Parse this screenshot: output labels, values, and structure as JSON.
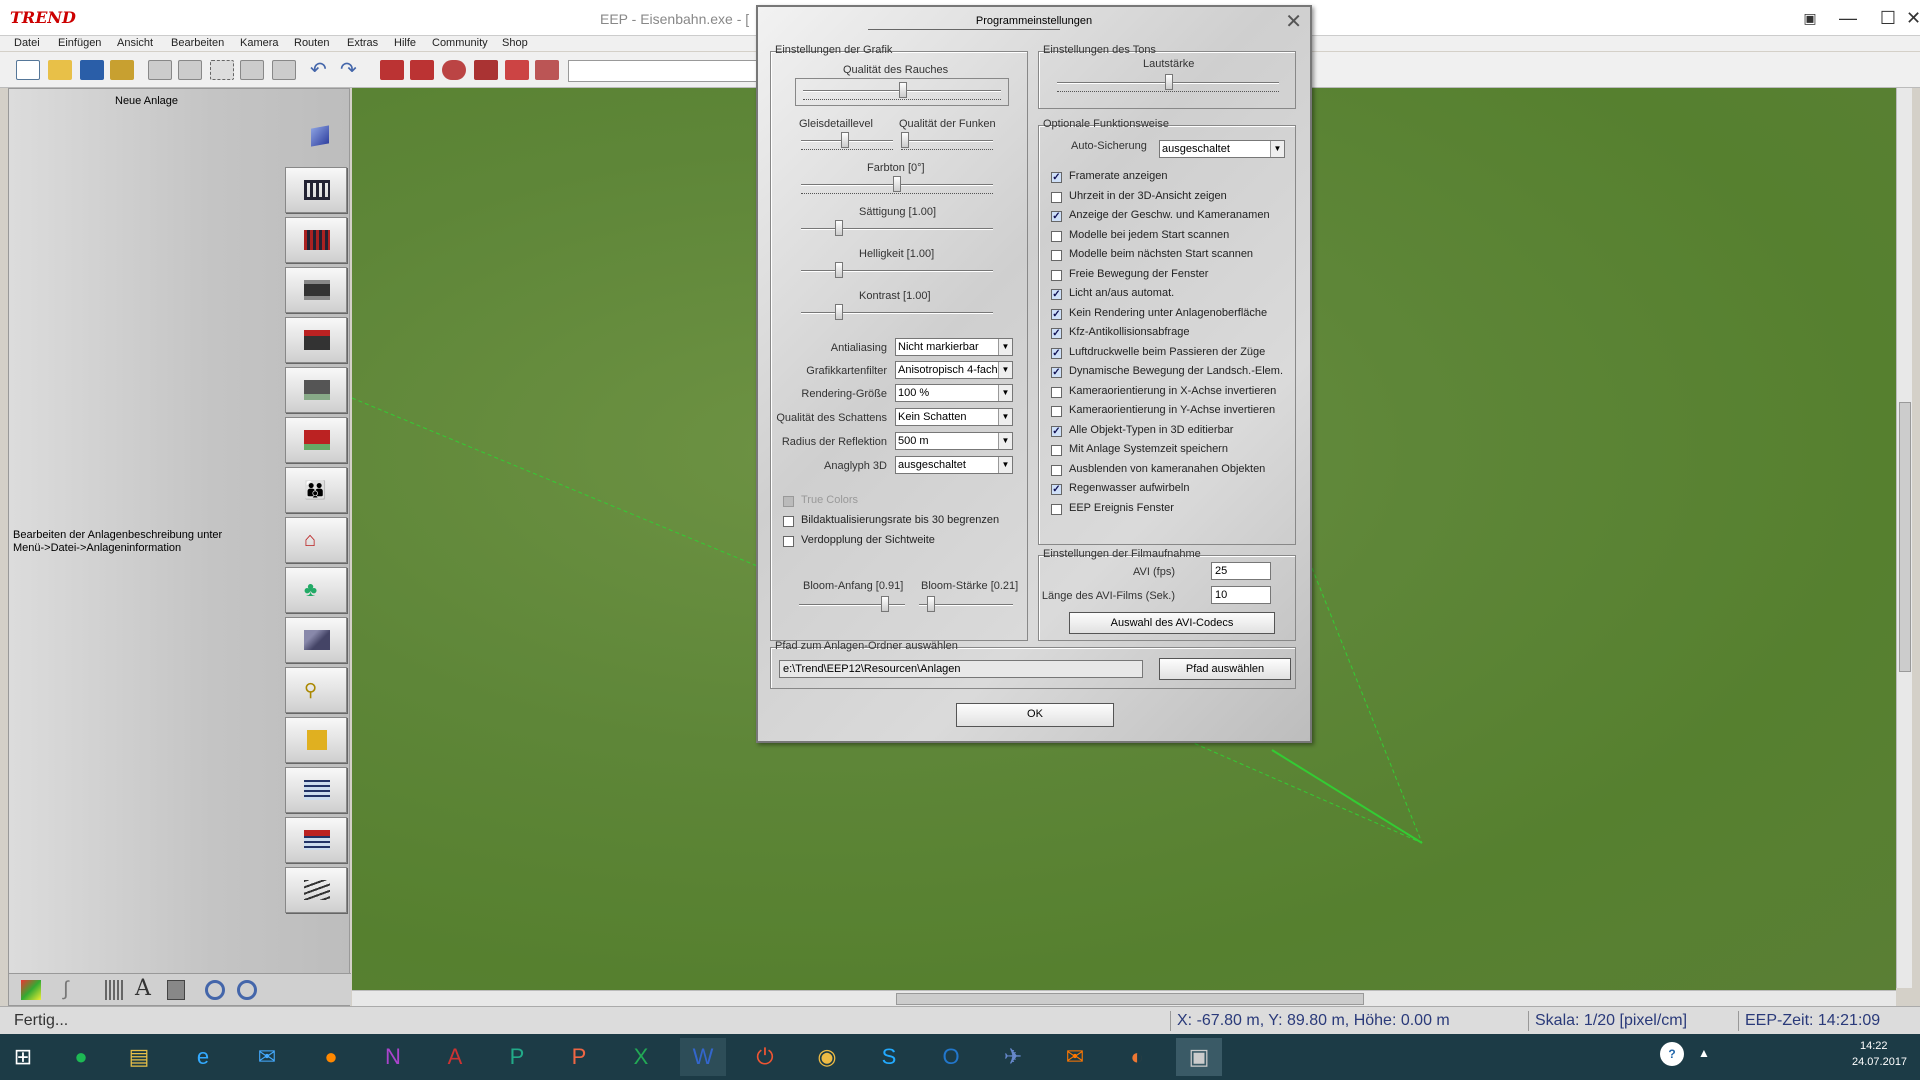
{
  "window": {
    "title": "EEP - Eisenbahn.exe - [",
    "logo": "TREND"
  },
  "menu": [
    "Datei",
    "Einfügen",
    "Ansicht",
    "Bearbeiten",
    "Kamera",
    "Routen",
    "Extras",
    "Hilfe",
    "Community",
    "Shop"
  ],
  "left_panel": {
    "title": "Neue Anlage",
    "description": "Bearbeiten der Anlagenbeschreibung unter Menü->Datei->Anlageninformation",
    "buttons": [
      "rails-icon",
      "tram-rails-icon",
      "road-icon",
      "road-tram-icon",
      "road-track-icon",
      "water-track-icon",
      "people-icon",
      "house-icon",
      "tree-icon",
      "landscape-icon",
      "signal-icon",
      "goods-icon",
      "water-icon",
      "water-surface-icon",
      "tracks-switch-icon"
    ]
  },
  "statusbar": {
    "state": "Fertig...",
    "coords": "X: -67.80 m, Y: 89.80 m, Höhe: 0.00 m",
    "scale": "Skala: 1/20 [pixel/cm]",
    "time": "EEP-Zeit: 14:21:09"
  },
  "dialog": {
    "title": "Programmeinstellungen",
    "graphics": {
      "label": "Einstellungen der Grafik",
      "smoke_label": "Qualität des Rauches",
      "track_detail_label": "Gleisdetaillevel",
      "sparks_label": "Qualität der Funken",
      "hue_label": "Farbton [0°]",
      "saturation_label": "Sättigung [1.00]",
      "brightness_label": "Helligkeit [1.00]",
      "contrast_label": "Kontrast [1.00]",
      "dropdowns": [
        {
          "label": "Antialiasing",
          "value": "Nicht markierbar"
        },
        {
          "label": "Grafikkartenfilter",
          "value": "Anisotropisch 4-fach"
        },
        {
          "label": "Rendering-Größe",
          "value": "100 %"
        },
        {
          "label": "Qualität des Schattens",
          "value": "Kein Schatten"
        },
        {
          "label": "Radius der Reflektion",
          "value": "500 m"
        },
        {
          "label": "Anaglyph 3D",
          "value": "ausgeschaltet"
        }
      ],
      "checkboxes": [
        {
          "label": "True Colors",
          "checked": false,
          "disabled": true
        },
        {
          "label": "Bildaktualisierungsrate bis 30 begrenzen",
          "checked": false,
          "disabled": false
        },
        {
          "label": "Verdopplung der Sichtweite",
          "checked": false,
          "disabled": false
        }
      ],
      "bloom_start_label": "Bloom-Anfang [0.91]",
      "bloom_strength_label": "Bloom-Stärke [0.21]"
    },
    "sound": {
      "label": "Einstellungen des Tons",
      "volume_label": "Lautstärke"
    },
    "optional": {
      "label": "Optionale Funktionsweise",
      "autosave_label": "Auto-Sicherung",
      "autosave_value": "ausgeschaltet",
      "checkboxes": [
        {
          "label": "Framerate anzeigen",
          "checked": true
        },
        {
          "label": "Uhrzeit in der 3D-Ansicht zeigen",
          "checked": false
        },
        {
          "label": "Anzeige der Geschw. und Kameranamen",
          "checked": true
        },
        {
          "label": "Modelle bei jedem Start scannen",
          "checked": false
        },
        {
          "label": "Modelle beim nächsten Start scannen",
          "checked": false
        },
        {
          "label": "Freie Bewegung der Fenster",
          "checked": false
        },
        {
          "label": "Licht an/aus automat.",
          "checked": true
        },
        {
          "label": "Kein Rendering unter Anlagenoberfläche",
          "checked": true
        },
        {
          "label": "Kfz-Antikollisionsabfrage",
          "checked": true
        },
        {
          "label": "Luftdruckwelle beim Passieren der Züge",
          "checked": true
        },
        {
          "label": "Dynamische Bewegung der Landsch.-Elem.",
          "checked": true
        },
        {
          "label": "Kameraorientierung in X-Achse invertieren",
          "checked": false
        },
        {
          "label": "Kameraorientierung in Y-Achse invertieren",
          "checked": false
        },
        {
          "label": "Alle Objekt-Typen in 3D editierbar",
          "checked": true
        },
        {
          "label": "Mit Anlage Systemzeit speichern",
          "checked": false
        },
        {
          "label": "Ausblenden von kameranahen Objekten",
          "checked": false
        },
        {
          "label": "Regenwasser aufwirbeln",
          "checked": true
        },
        {
          "label": "EEP Ereignis Fenster",
          "checked": false
        }
      ]
    },
    "film": {
      "label": "Einstellungen der Filmaufnahme",
      "avi_fps_label": "AVI (fps)",
      "avi_fps_value": "25",
      "avi_length_label": "Länge des AVI-Films (Sek.)",
      "avi_length_value": "10",
      "codec_button": "Auswahl des AVI-Codecs"
    },
    "path": {
      "label": "Pfad zum Anlagen-Ordner auswählen",
      "value": "e:\\Trend\\EEP12\\Resourcen\\Anlagen",
      "button": "Pfad auswählen"
    },
    "ok": "OK"
  },
  "taskbar": {
    "apps": [
      "windows-icon",
      "spotify-icon",
      "explorer-icon",
      "ie-icon",
      "outlook-app-icon",
      "firefox-icon",
      "onenote-icon",
      "access-icon",
      "publisher-icon",
      "powerpoint-icon",
      "excel-icon",
      "word-icon",
      "power-icon",
      "chrome-icon",
      "skype-icon",
      "outlook-icon",
      "thunderbird-icon",
      "mail-icon",
      "pdf-icon",
      "eep-icon"
    ],
    "time": "14:22",
    "date": "24.07.2017"
  }
}
